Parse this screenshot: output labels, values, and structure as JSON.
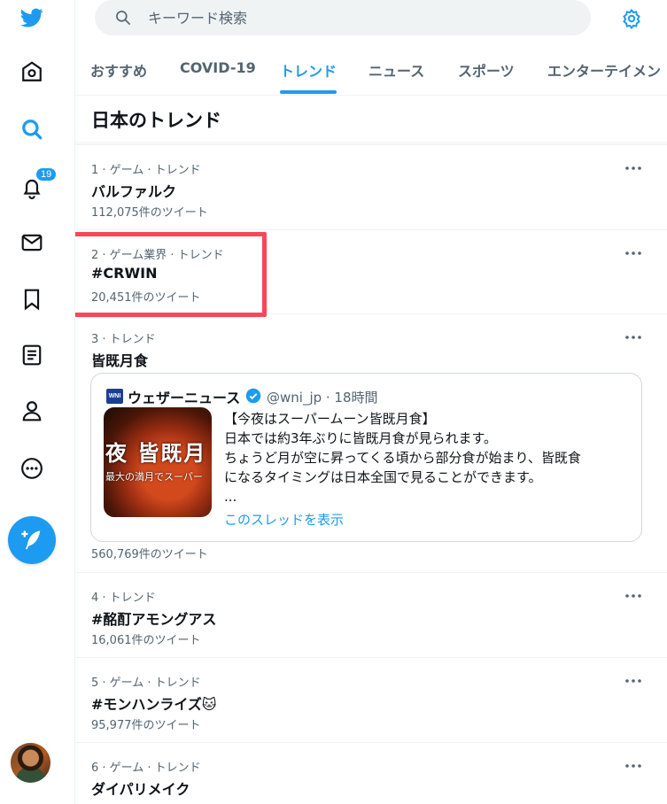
{
  "sidebar": {
    "items": [
      {
        "name": "home",
        "icon": "home-icon"
      },
      {
        "name": "explore",
        "icon": "search-icon",
        "active": true
      },
      {
        "name": "notifications",
        "icon": "bell-icon",
        "badge": "19"
      },
      {
        "name": "messages",
        "icon": "mail-icon"
      },
      {
        "name": "bookmarks",
        "icon": "bookmark-icon"
      },
      {
        "name": "lists",
        "icon": "list-icon"
      },
      {
        "name": "profile",
        "icon": "person-icon"
      },
      {
        "name": "more",
        "icon": "more-circle-icon"
      }
    ],
    "notification_badge": "19"
  },
  "search": {
    "placeholder": "キーワード検索"
  },
  "tabs": [
    {
      "label": "おすすめ",
      "active": false
    },
    {
      "label": "COVID-19",
      "active": false
    },
    {
      "label": "トレンド",
      "active": true
    },
    {
      "label": "ニュース",
      "active": false
    },
    {
      "label": "スポーツ",
      "active": false
    },
    {
      "label": "エンターテイメン",
      "active": false
    }
  ],
  "section_title": "日本のトレンド",
  "trends": [
    {
      "meta": "1 · ゲーム · トレンド",
      "name": "バルファルク",
      "count": "112,075件のツイート"
    },
    {
      "meta": "2 · ゲーム業界 · トレンド",
      "name": "#CRWIN",
      "count": "20,451件のツイート"
    },
    {
      "meta": "3 · トレンド",
      "name": "皆既月食",
      "count": "560,769件のツイート"
    },
    {
      "meta": "4 · トレンド",
      "name": "#酩酊アモングアス",
      "count": "16,061件のツイート"
    },
    {
      "meta": "5 · ゲーム · トレンド",
      "name": "#モンハンライズ🐱",
      "count": "95,977件のツイート"
    },
    {
      "meta": "6 · ゲーム · トレンド",
      "name": "ダイパリメイク",
      "count": ""
    }
  ],
  "embed": {
    "logo_text": "WNI",
    "account": "ウェザーニュース",
    "handle": "@wni_jp · 18時間",
    "thumb_title": "夜 皆既月",
    "thumb_sub": "最大の満月でスーパー",
    "lines": [
      "【今夜はスーパームーン皆既月食】",
      "日本では約3年ぶりに皆既月食が見られます。",
      "ちょうど月が空に昇ってくる頃から部分食が始まり、皆既食",
      "になるタイミングは日本全国で見ることができます。",
      "..."
    ],
    "thread_link": "このスレッドを表示"
  },
  "colors": {
    "accent": "#1d9bf0",
    "highlight": "#fa4758",
    "muted_text": "#536471"
  }
}
